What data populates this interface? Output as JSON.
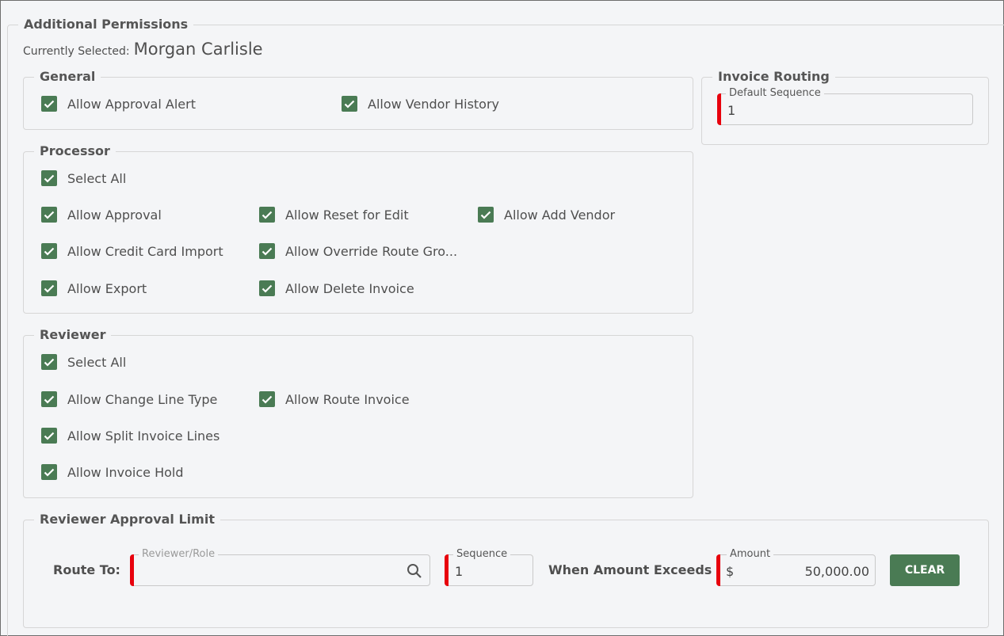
{
  "section_title": "Additional Permissions",
  "current": {
    "label": "Currently Selected:",
    "name": "Morgan Carlisle"
  },
  "general": {
    "title": "General",
    "items": [
      "Allow Approval Alert",
      "Allow Vendor History"
    ]
  },
  "invoice_routing": {
    "title": "Invoice Routing",
    "default_sequence_label": "Default Sequence",
    "default_sequence_value": "1"
  },
  "processor": {
    "title": "Processor",
    "select_all": "Select All",
    "items": [
      "Allow Approval",
      "Allow Reset for Edit",
      "Allow Add Vendor",
      "Allow Credit Card Import",
      "Allow Override Route Gro...",
      "Allow Export",
      "Allow Delete Invoice"
    ]
  },
  "reviewer": {
    "title": "Reviewer",
    "select_all": "Select All",
    "items": [
      "Allow Change Line Type",
      "Allow Route Invoice",
      "Allow Split Invoice Lines",
      "Allow Invoice Hold"
    ]
  },
  "approval_limit": {
    "title": "Reviewer Approval Limit",
    "route_to_label": "Route To:",
    "reviewer_placeholder": "Reviewer/Role",
    "sequence_label": "Sequence",
    "sequence_value": "1",
    "when_label": "When Amount Exceeds",
    "amount_label": "Amount",
    "currency": "$",
    "amount_value": "50,000.00",
    "clear_button": "CLEAR"
  },
  "colors": {
    "accent": "#4a7b54",
    "required": "#e8000d"
  },
  "icons": {
    "checkbox": "check-icon",
    "search": "search-icon"
  }
}
